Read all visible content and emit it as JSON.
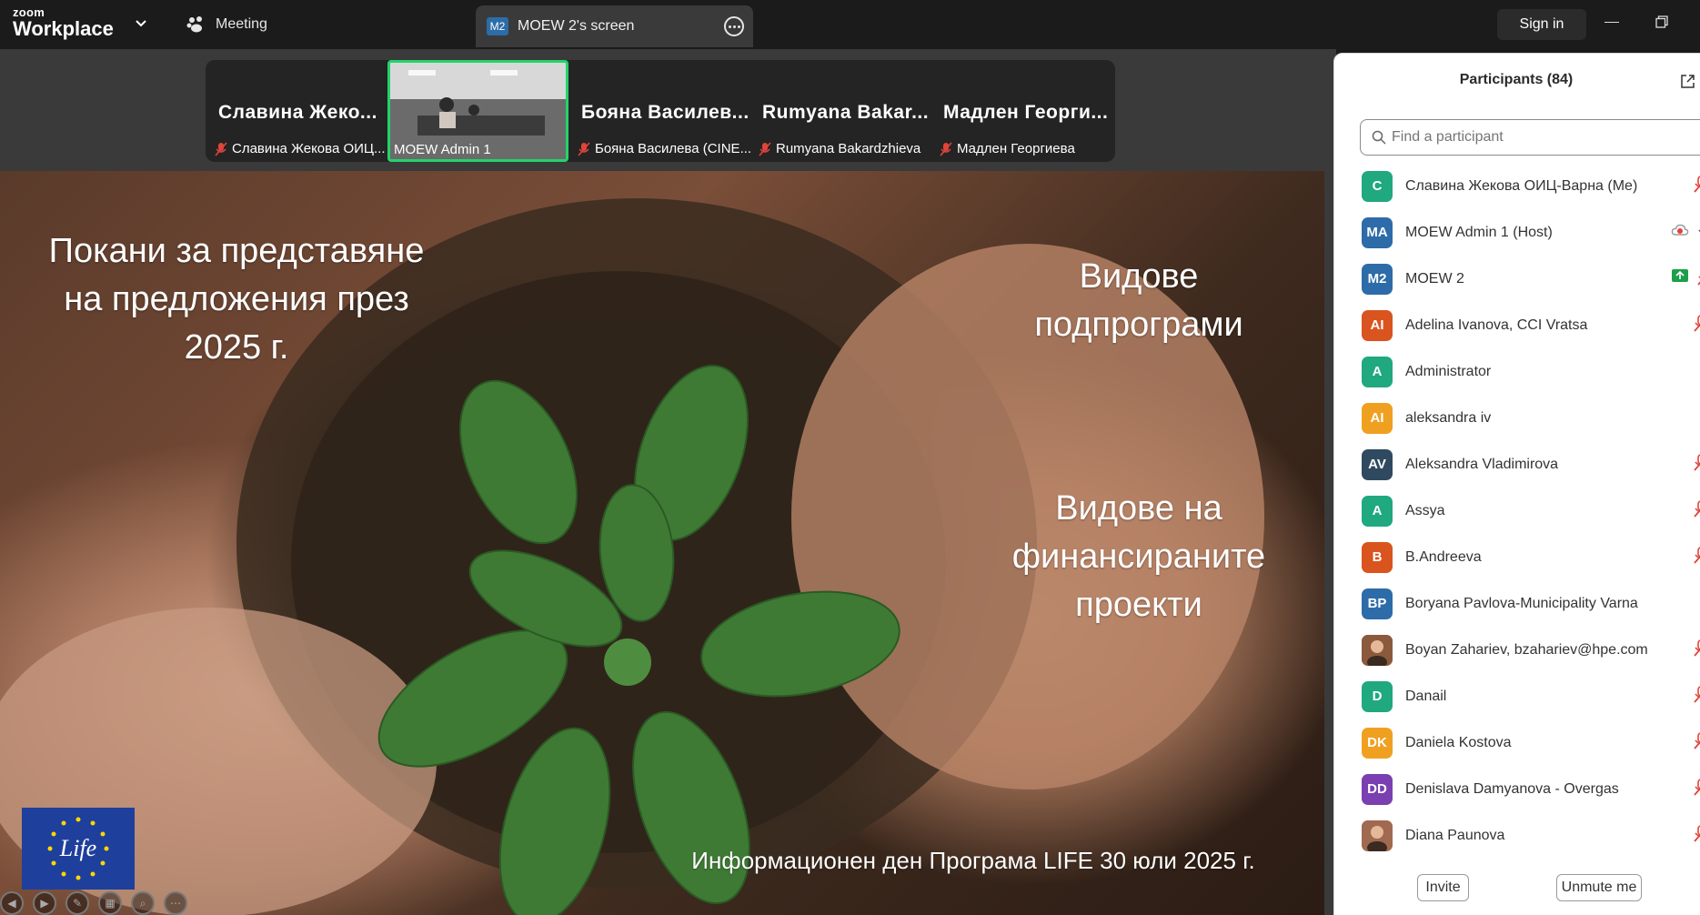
{
  "topbar": {
    "brand_small": "zoom",
    "brand_big": "Workplace",
    "meeting_label": "Meeting",
    "screen_badge": "M2",
    "screen_label": "MOEW 2's screen",
    "signin_label": "Sign in"
  },
  "strip": {
    "tiles": [
      {
        "name": "Славина  Жеко...",
        "label": "Славина Жекова ОИЦ...",
        "muted": true
      },
      {
        "name": "",
        "label": "MOEW Admin 1",
        "muted": false,
        "active": true
      },
      {
        "name": "Бояна  Василев...",
        "label": "Бояна Василева (CINE...",
        "muted": true
      },
      {
        "name": "Rumyana  Bakar...",
        "label": "Rumyana Bakardzhieva",
        "muted": true
      },
      {
        "name": "Мадлен  Георги...",
        "label": "Мадлен Георгиева",
        "muted": true
      }
    ]
  },
  "slide": {
    "title_left": "Покани за представяне\nна предложения през\n2025 г.",
    "title_right_top": "Видове\nподпрограми",
    "title_right_mid": "Видове на\nфинансираните\nпроекти",
    "footer": "Информационен ден Програма LIFE 30 юли 2025 г.",
    "logo_text": "Life"
  },
  "panel": {
    "title": "Participants (84)",
    "search_placeholder": "Find a participant",
    "participants": [
      {
        "initials": "C",
        "name": "Славина Жекова ОИЦ-Варна (Me)",
        "color": "#20a87e",
        "icons": [
          "mic-off",
          "video-off"
        ]
      },
      {
        "initials": "MA",
        "name": "MOEW Admin 1 (Host)",
        "color": "#2d6ca8",
        "icons": [
          "cloud-record",
          "mic",
          "video"
        ]
      },
      {
        "initials": "M2",
        "name": "MOEW 2",
        "color": "#2d6ca8",
        "icons": [
          "share-screen",
          "mic-off",
          "video-off"
        ]
      },
      {
        "initials": "AI",
        "name": "Adelina Ivanova, CCI Vratsa",
        "color": "#d9541e",
        "icons": [
          "mic-off",
          "video-off"
        ]
      },
      {
        "initials": "A",
        "name": "Administrator",
        "color": "#20a87e",
        "icons": [
          "mic-off-edge"
        ]
      },
      {
        "initials": "AI",
        "name": "aleksandra iv",
        "color": "#f0a020",
        "icons": [
          "mic-off-edge"
        ]
      },
      {
        "initials": "AV",
        "name": "Aleksandra Vladimirova",
        "color": "#2f4a60",
        "icons": [
          "mic-off",
          "video-off"
        ]
      },
      {
        "initials": "A",
        "name": "Assya",
        "color": "#20a87e",
        "icons": [
          "mic-off",
          "video-off"
        ]
      },
      {
        "initials": "B",
        "name": "B.Andreeva",
        "color": "#d9541e",
        "icons": [
          "mic-off",
          "video-off"
        ]
      },
      {
        "initials": "BP",
        "name": "Boryana Pavlova-Municipality Varna",
        "color": "#2d6ca8",
        "icons": [
          "mic-off-edge"
        ]
      },
      {
        "initials": "",
        "name": "Boyan Zahariev, bzahariev@hpe.com",
        "color": "#8b5a3c",
        "photo": true,
        "icons": [
          "mic-off",
          "video-off"
        ]
      },
      {
        "initials": "D",
        "name": "Danail",
        "color": "#20a87e",
        "icons": [
          "mic-off",
          "video-off"
        ]
      },
      {
        "initials": "DK",
        "name": "Daniela Kostova",
        "color": "#f0a020",
        "icons": [
          "mic-off",
          "video-off"
        ]
      },
      {
        "initials": "DD",
        "name": "Denislava Damyanova - Overgas",
        "color": "#7a3fb0",
        "icons": [
          "mic-off",
          "video-off"
        ]
      },
      {
        "initials": "",
        "name": "Diana Paunova",
        "color": "#a06a50",
        "photo": true,
        "icons": [
          "mic-off",
          "video-off"
        ]
      }
    ],
    "invite_label": "Invite",
    "unmute_label": "Unmute me"
  }
}
